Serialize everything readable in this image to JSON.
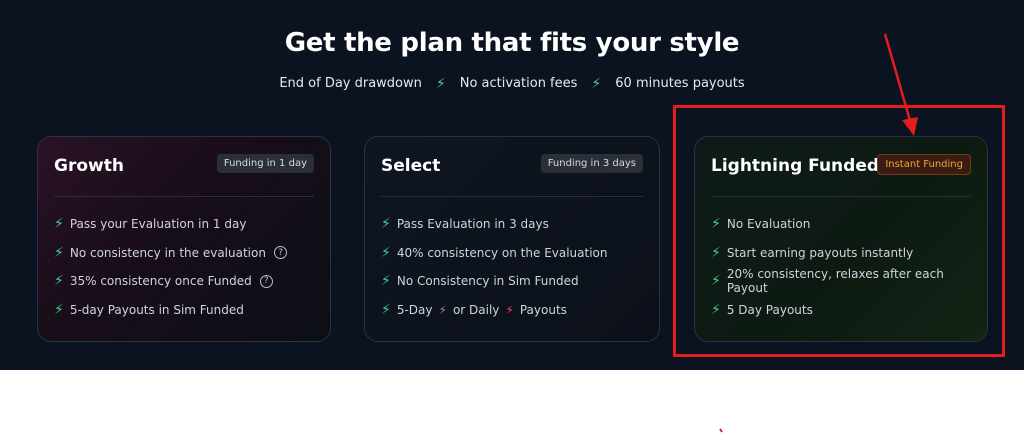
{
  "title": "Get the plan that fits your style",
  "features": [
    {
      "label": "End of Day drawdown"
    },
    {
      "label": "No activation fees"
    },
    {
      "label": "60 minutes payouts"
    }
  ],
  "cards": [
    {
      "name": "Growth",
      "badge": "Funding in 1 day",
      "items": [
        "Pass your Evaluation in 1 day",
        "No consistency in the evaluation",
        "35% consistency once Funded",
        "5-day Payouts in Sim Funded"
      ]
    },
    {
      "name": "Select",
      "badge": "Funding in 3 days",
      "items": [
        "Pass Evaluation in 3 days",
        "40% consistency on the Evaluation",
        "No Consistency in Sim Funded"
      ],
      "last_item": {
        "part1": "5-Day",
        "part2": "or Daily",
        "part3": "Payouts"
      }
    },
    {
      "name": "Lightning Funded",
      "badge": "Instant Funding",
      "items": [
        "No Evaluation",
        "Start earning payouts instantly",
        "20% consistency, relaxes after each Payout",
        "5 Day Payouts"
      ]
    }
  ],
  "icons": {
    "bolt": "⚡",
    "help": "?"
  },
  "colors": {
    "background": "#0b1320",
    "bolt_green": "#3fd08a",
    "instant_badge": "#f2a23c",
    "annotation_red": "#e11d1d"
  }
}
